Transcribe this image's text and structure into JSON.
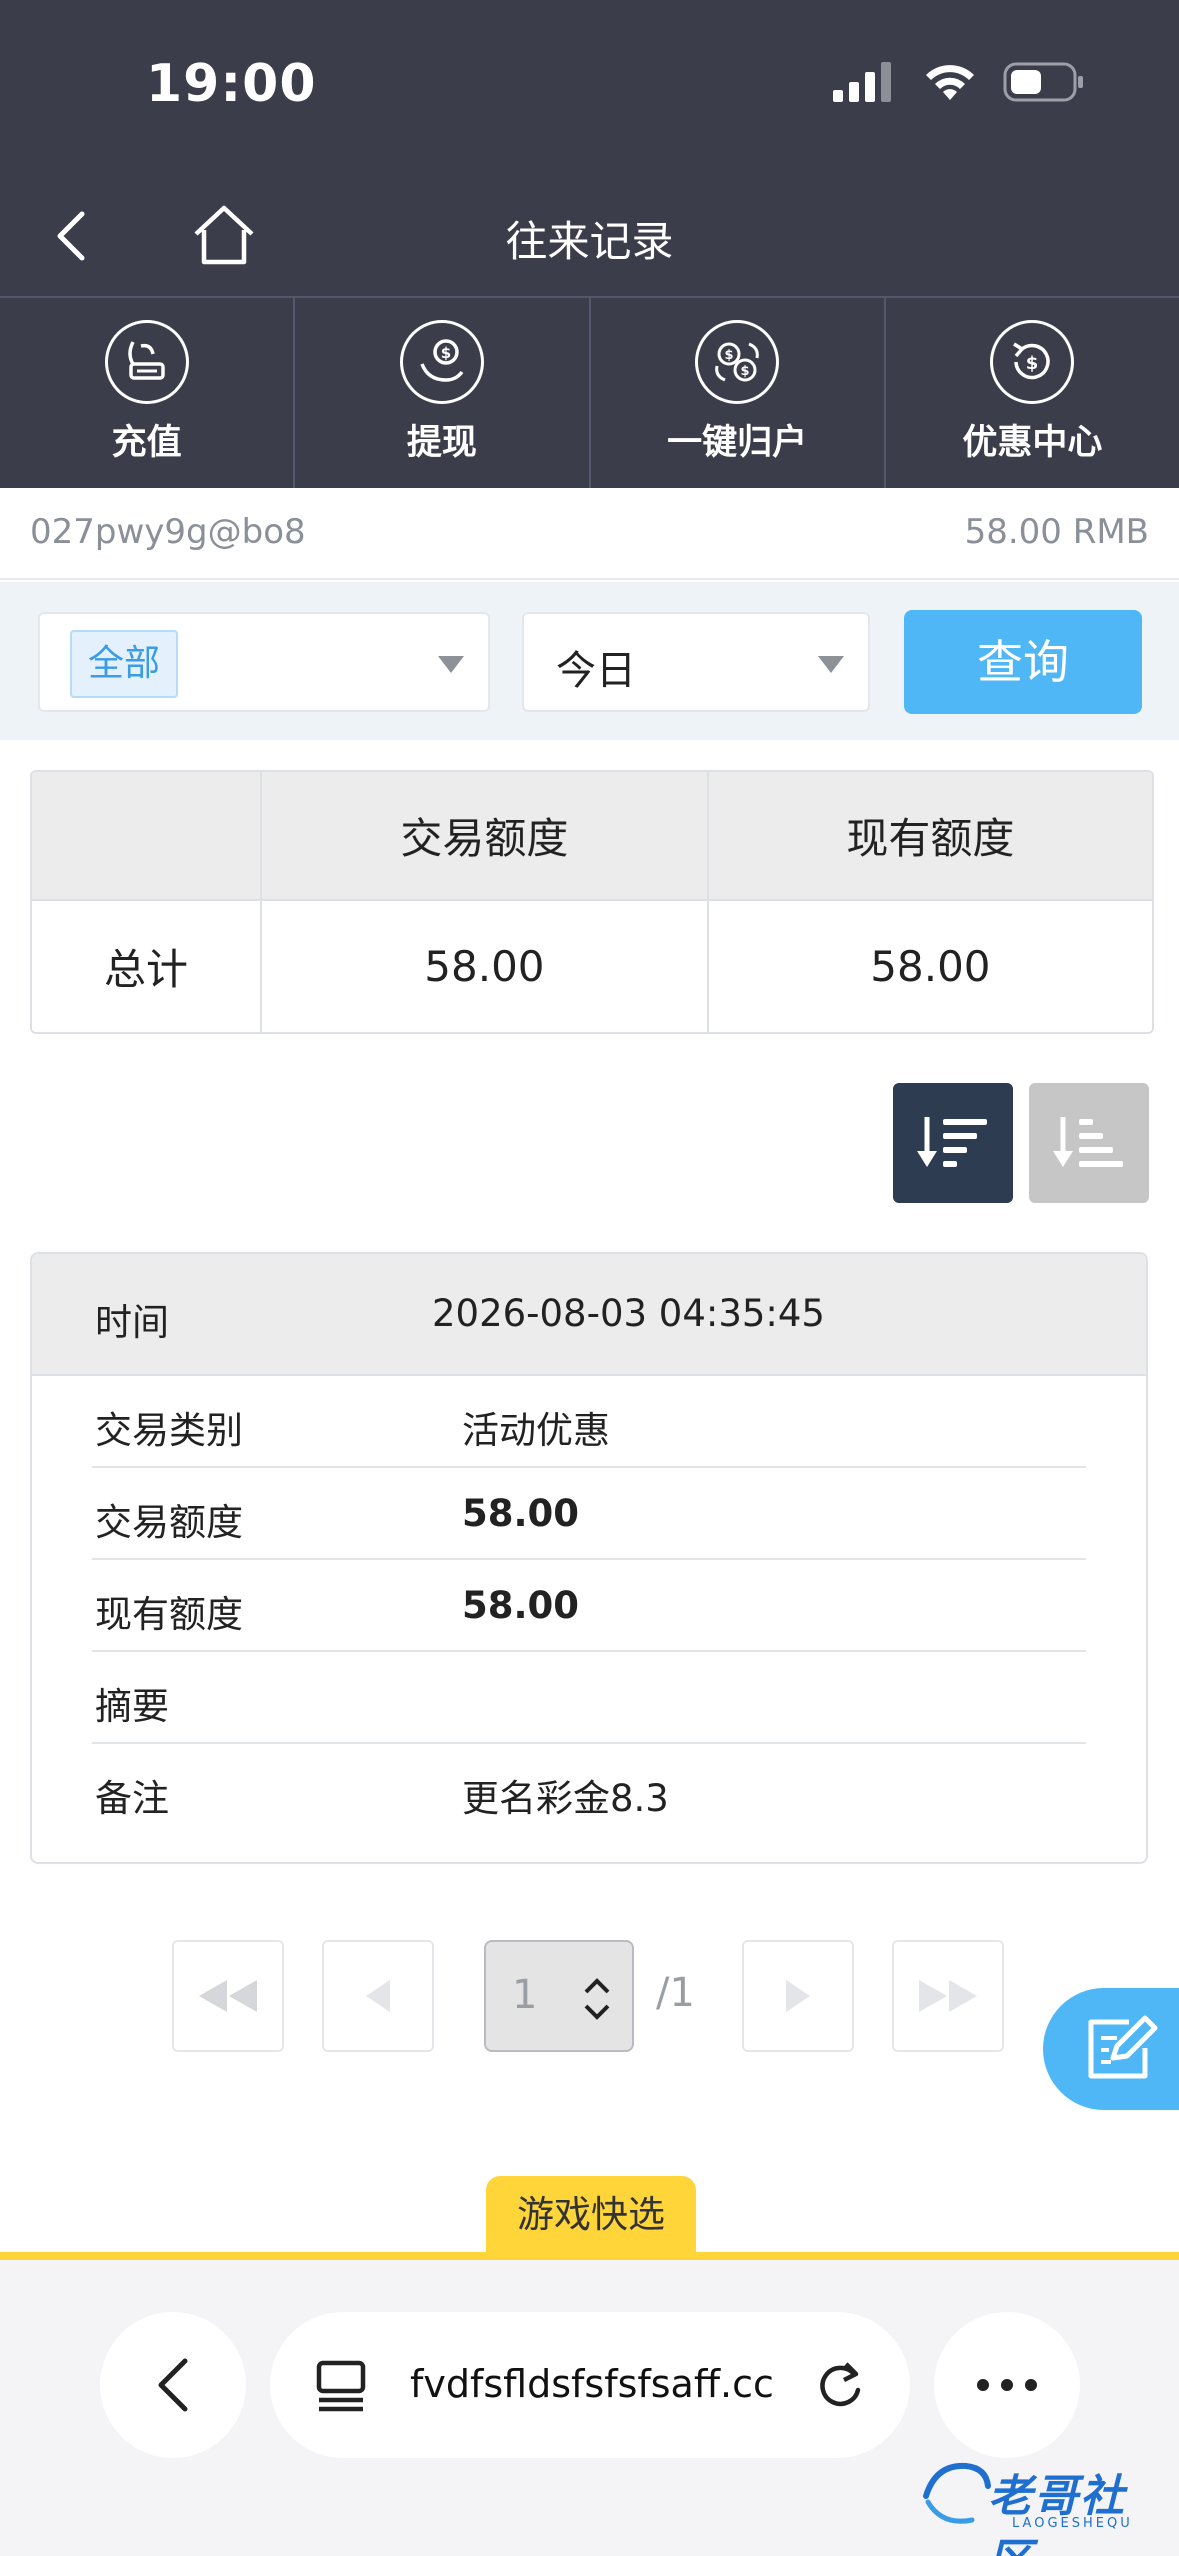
{
  "status_bar": {
    "time": "19:00"
  },
  "nav": {
    "title": "往来记录"
  },
  "quick_actions": [
    {
      "label": "充值",
      "icon": "recharge-icon"
    },
    {
      "label": "提现",
      "icon": "withdraw-icon"
    },
    {
      "label": "一键归户",
      "icon": "transfer-icon"
    },
    {
      "label": "优惠中心",
      "icon": "promo-icon"
    }
  ],
  "account": {
    "username": "027pwy9g@bo8",
    "balance": "58.00 RMB"
  },
  "filters": {
    "type_selected": "全部",
    "date_selected": "今日",
    "query_label": "查询"
  },
  "summary": {
    "headers": [
      "",
      "交易额度",
      "现有额度"
    ],
    "row_label": "总计",
    "trade_amount": "58.00",
    "current_amount": "58.00"
  },
  "record": {
    "time_label": "时间",
    "time_value": "2026-08-03 04:35:45",
    "rows": [
      {
        "label": "交易类别",
        "value": "活动优惠"
      },
      {
        "label": "交易额度",
        "value": "58.00"
      },
      {
        "label": "现有额度",
        "value": "58.00"
      },
      {
        "label": "摘要",
        "value": ""
      },
      {
        "label": "备注",
        "value": "更名彩金8.3"
      }
    ]
  },
  "pagination": {
    "current": "1",
    "total": "/1"
  },
  "game_tab": {
    "label": "游戏快选"
  },
  "browser": {
    "url": "fvdfsfldsfsfsfsaff.cc"
  },
  "watermark": {
    "text": "老哥社区",
    "sub": "LAOGESHEQU"
  },
  "colors": {
    "header_bg": "#3b3d4b",
    "accent_blue": "#4fb7f6",
    "gold": "#ffd53a",
    "sort_active": "#2e3c52"
  }
}
